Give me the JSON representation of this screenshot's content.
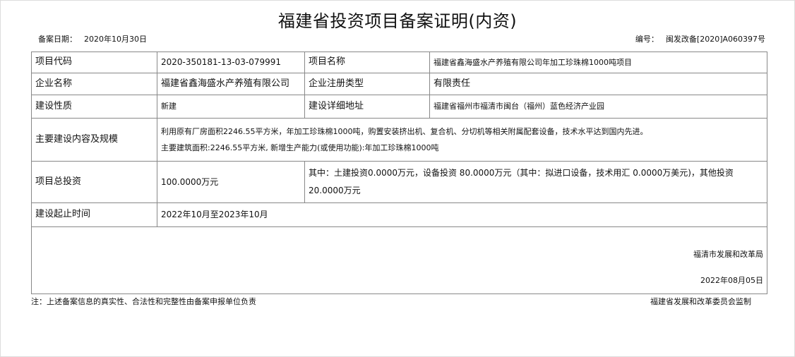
{
  "document": {
    "title": "福建省投资项目备案证明(内资)",
    "filing_date_label": "备案日期：",
    "filing_date": "2020年10月30日",
    "number_label": "编号：",
    "number": "闽发改备[2020]A060397号"
  },
  "table": {
    "project_code_label": "项目代码",
    "project_code": "2020-350181-13-03-079991",
    "project_name_label": "项目名称",
    "project_name": "福建省鑫海盛水产养殖有限公司年加工珍珠棉1000吨项目",
    "company_name_label": "企业名称",
    "company_name": "福建省鑫海盛水产养殖有限公司",
    "company_type_label": "企业注册类型",
    "company_type": "有限责任",
    "construction_nature_label": "建设性质",
    "construction_nature": "新建",
    "address_label": "建设详细地址",
    "address": "福建省福州市福清市闽台（福州）蓝色经济产业园",
    "scope_label": "主要建设内容及规模",
    "scope_line1": "利用原有厂房面积2246.55平方米，年加工珍珠棉1000吨，购置安装挤出机、复合机、分切机等相关附属配套设备，技术水平达到国内先进。",
    "scope_line2": "主要建筑面积:2246.55平方米, 新增生产能力(或使用功能):年加工珍珠棉1000吨",
    "investment_label": "项目总投资",
    "investment_total": "100.0000万元",
    "investment_detail_line1": "其中：土建投资0.0000万元，设备投资 80.0000万元（其中：拟进口设备，技术用汇 0.0000万美元)，其他投资",
    "investment_detail_line2": "20.0000万元",
    "period_label": "建设起止时间",
    "period": "2022年10月至2023年10月"
  },
  "signature": {
    "organization": "福清市发展和改革局",
    "date": "2022年08月05日"
  },
  "footer": {
    "note": "注：上述备案信息的真实性、合法性和完整性由备案申报单位负责",
    "supervisor": "福建省发展和改革委员会监制"
  }
}
